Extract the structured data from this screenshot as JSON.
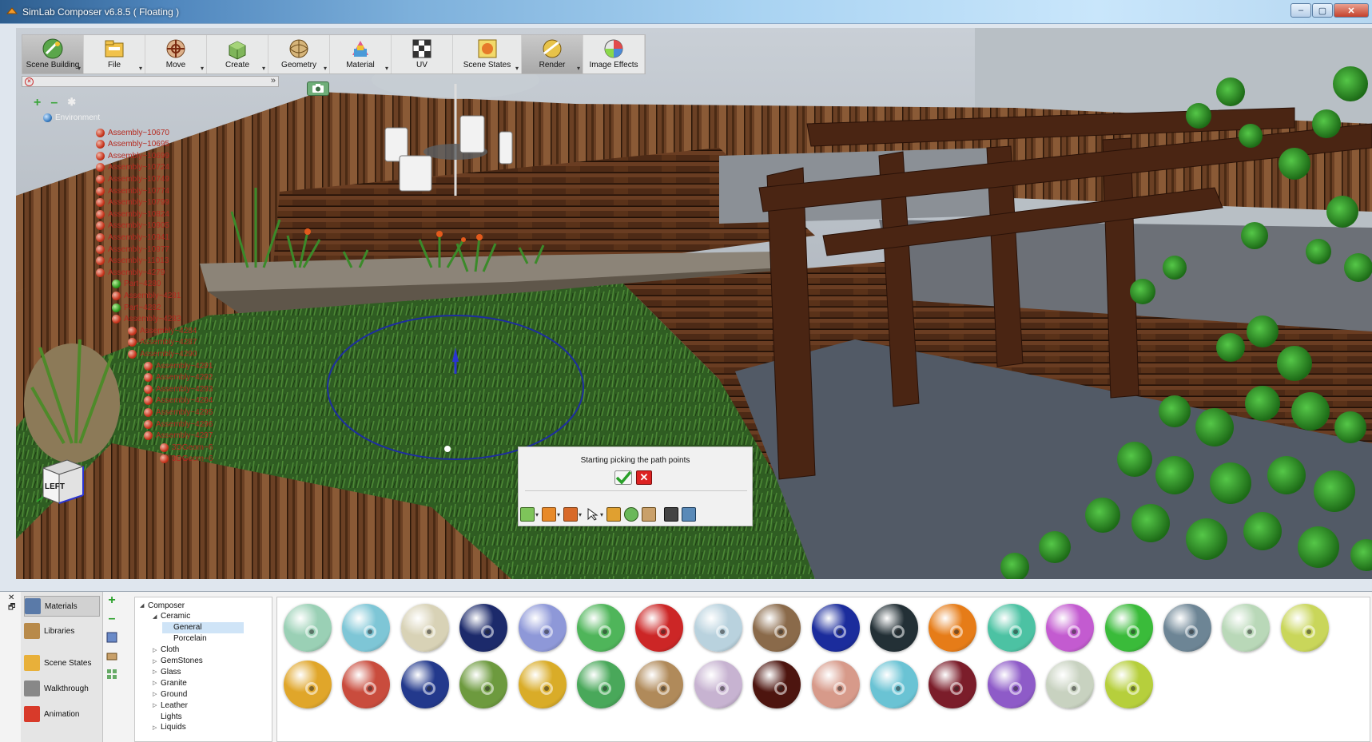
{
  "window": {
    "title": "SimLab Composer v6.8.5 ( Floating )",
    "controls": {
      "minimize": "–",
      "maximize": "▢",
      "close": "✕"
    }
  },
  "ribbon": {
    "buttons": [
      {
        "label": "Scene Building",
        "icon": "scene-building-icon",
        "active": true
      },
      {
        "label": "File",
        "icon": "file-icon",
        "active": false
      },
      {
        "label": "Move",
        "icon": "move-icon",
        "active": false
      },
      {
        "label": "Create",
        "icon": "create-icon",
        "active": false
      },
      {
        "label": "Geometry",
        "icon": "geometry-icon",
        "active": false
      },
      {
        "label": "Material",
        "icon": "material-icon",
        "active": false
      },
      {
        "label": "UV",
        "icon": "uv-icon",
        "active": false
      },
      {
        "label": "Scene States",
        "icon": "scene-states-icon",
        "active": false
      },
      {
        "label": "Render",
        "icon": "render-icon",
        "active": true
      },
      {
        "label": "Image Effects",
        "icon": "image-effects-icon",
        "active": false
      }
    ]
  },
  "tree": {
    "add": "+",
    "remove": "–",
    "environment": "Environment",
    "nodes": [
      "Assembly~10670",
      "Assembly~10695",
      "Assembly~10699",
      "Assembly~10724",
      "Assembly~10749",
      "Assembly~10774",
      "Assembly~10799",
      "Assembly~10824",
      "Assembly~10905",
      "Assembly~10941",
      "Assembly~10977",
      "Assembly~11013",
      "Assembly~4279",
      "Part~4280",
      "Assembly~4281",
      "Part~4282",
      "Assembly~4283",
      "Assembly~4284",
      "Assembly~4287",
      "Assembly~4290",
      "Assembly~4291",
      "Assembly~4292",
      "Assembly~4293",
      "Assembly~4294",
      "Assembly~4295",
      "Assembly~4296",
      "Assembly~4297",
      "3DGeom~6",
      "3DGeom~6"
    ]
  },
  "viewcube": {
    "face": "LEFT"
  },
  "path_dialog": {
    "message": "Starting picking the path points",
    "confirm_icon": "checkmark-icon",
    "cancel_icon": "x-icon"
  },
  "bottom": {
    "dock_close": "✕",
    "dock_float": "🗗",
    "sidebar": [
      {
        "label": "Materials",
        "icon": "materials-icon",
        "active": true
      },
      {
        "label": "Libraries",
        "icon": "libraries-icon",
        "active": false
      },
      {
        "label": "Scene States",
        "icon": "scene-states-icon",
        "active": false
      },
      {
        "label": "Walkthrough",
        "icon": "walkthrough-icon",
        "active": false
      },
      {
        "label": "Animation",
        "icon": "animation-icon",
        "active": false
      }
    ],
    "library_tree": [
      {
        "label": "Composer",
        "level": 0,
        "twisty": "◢"
      },
      {
        "label": "Ceramic",
        "level": 1,
        "twisty": "◢"
      },
      {
        "label": "General",
        "level": 2,
        "twisty": "",
        "selected": true
      },
      {
        "label": "Porcelain",
        "level": 2,
        "twisty": ""
      },
      {
        "label": "Cloth",
        "level": 1,
        "twisty": "▷"
      },
      {
        "label": "GemStones",
        "level": 1,
        "twisty": "▷"
      },
      {
        "label": "Glass",
        "level": 1,
        "twisty": "▷"
      },
      {
        "label": "Granite",
        "level": 1,
        "twisty": "▷"
      },
      {
        "label": "Ground",
        "level": 1,
        "twisty": "▷"
      },
      {
        "label": "Leather",
        "level": 1,
        "twisty": "▷"
      },
      {
        "label": "Lights",
        "level": 1,
        "twisty": ""
      },
      {
        "label": "Liquids",
        "level": 1,
        "twisty": "▷"
      }
    ],
    "swatches": [
      [
        "#9ad0b5",
        "#7ec6d6",
        "#d8d2b6",
        "#1c2a6b",
        "#8e98d8",
        "#4fb55a",
        "#cc2626",
        "#b9d2de",
        "#8a6a4a",
        "#1b2c9c",
        "#233036",
        "#e67c18",
        "#4cc2a3",
        "#c35bd0",
        "#3abb3a",
        "#6d8595",
        "#b9d8b8",
        "#c9d65a"
      ],
      [
        "#e0a62a",
        "#c94c3d",
        "#23398c",
        "#6d9a3e",
        "#d9ac28",
        "#49a85a",
        "#b08a5a",
        "#c7b3d1",
        "#4d150f",
        "#d79a8a",
        "#6ac3d4",
        "#7b1d2a",
        "#8e5bc8",
        "#c8d2c0",
        "#b6cf3c"
      ]
    ]
  }
}
